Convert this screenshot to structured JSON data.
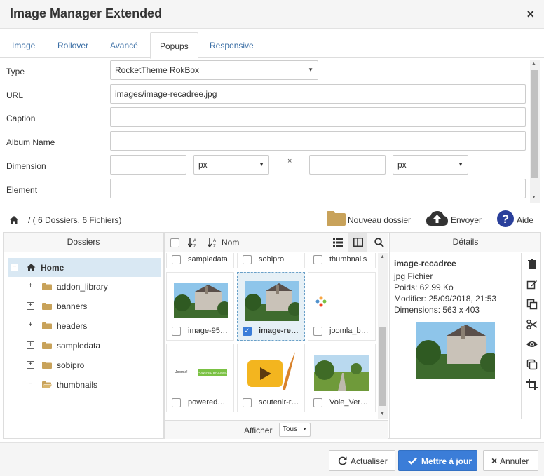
{
  "window": {
    "title": "Image Manager Extended",
    "close": "×"
  },
  "tabs": [
    "Image",
    "Rollover",
    "Avancé",
    "Popups",
    "Responsive"
  ],
  "form": {
    "type_label": "Type",
    "type_value": "RocketTheme RokBox",
    "url_label": "URL",
    "url_value": "images/image-recadree.jpg",
    "caption_label": "Caption",
    "album_label": "Album Name",
    "dimension_label": "Dimension",
    "unit1": "px",
    "times": "×",
    "unit2": "px",
    "element_label": "Element"
  },
  "path": {
    "summary": "/ ( 6 Dossiers, 6 Fichiers)"
  },
  "toolbar": {
    "new_folder": "Nouveau dossier",
    "upload": "Envoyer",
    "help": "Aide"
  },
  "folders": {
    "header": "Dossiers",
    "root": "Home",
    "items": [
      "addon_library",
      "banners",
      "headers",
      "sampledata",
      "sobipro",
      "thumbnails"
    ]
  },
  "files": {
    "sort_name": "Nom",
    "row_top": [
      "sampledata",
      "sobipro",
      "thumbnails"
    ],
    "items": [
      {
        "caption": "image-95…"
      },
      {
        "caption": "image-re…"
      },
      {
        "caption": "joomla_b…"
      },
      {
        "caption": "powered…"
      },
      {
        "caption": "soutenir-r…"
      },
      {
        "caption": "Voie_Ver…"
      }
    ],
    "display_label": "Afficher",
    "display_value": "Tous",
    "powered_label": "POWERED BY JOOMLA"
  },
  "details": {
    "header": "Détails",
    "name": "image-recadree",
    "kind": "jpg Fichier",
    "size": "Poids: 62.99 Ko",
    "modified": "Modifier: 25/09/2018, 21:53",
    "dimensions": "Dimensions: 563 x 403"
  },
  "buttons": {
    "refresh": "Actualiser",
    "update": "Mettre à jour",
    "cancel": "Annuler"
  },
  "colors": {
    "primary": "#3b7dd8",
    "link": "#3a6ea5",
    "folder": "#c8a25a"
  }
}
